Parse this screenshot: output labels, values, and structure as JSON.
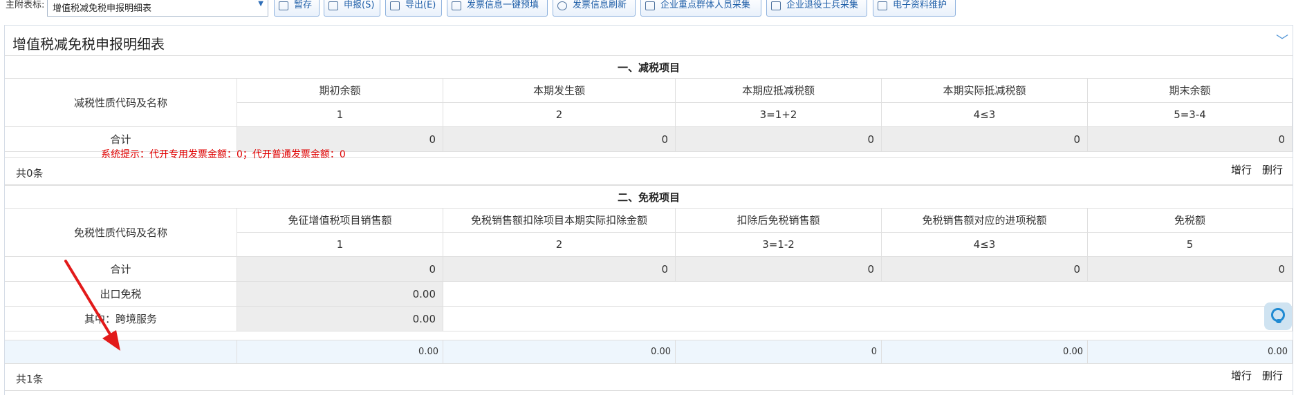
{
  "toolbar": {
    "label": "主附表标:",
    "select_value": "增值税减免税申报明细表",
    "buttons": {
      "save": "暂存",
      "declare": "申报(S)",
      "export": "导出(E)",
      "invoice_prefill": "发票信息一键预填",
      "invoice_refresh": "发票信息刷新",
      "key_group": "企业重点群体人员采集",
      "veteran": "企业退役士兵采集",
      "edoc": "电子资料维护"
    }
  },
  "panel": {
    "title": "增值税减免税申报明细表"
  },
  "tax_reduction": {
    "section_title": "一、减税项目",
    "row_header": "减税性质代码及名称",
    "columns": [
      "期初余额",
      "本期发生额",
      "本期应抵减税额",
      "本期实际抵减税额",
      "期末余额"
    ],
    "column_codes": [
      "1",
      "2",
      "3=1+2",
      "4≤3",
      "5=3-4"
    ],
    "total_label": "合计",
    "totals": [
      "0",
      "0",
      "0",
      "0",
      "0"
    ],
    "hint": "系统提示：代开专用发票金额：0；代开普通发票金额：0",
    "count": "共0条",
    "add_row": "增行",
    "delete_row": "删行"
  },
  "tax_exemption": {
    "section_title": "二、免税项目",
    "row_header": "免税性质代码及名称",
    "columns": [
      "免征增值税项目销售额",
      "免税销售额扣除项目本期实际扣除金额",
      "扣除后免税销售额",
      "免税销售额对应的进项税额",
      "免税额"
    ],
    "column_codes": [
      "1",
      "2",
      "3=1-2",
      "4≤3",
      "5"
    ],
    "total_label": "合计",
    "totals": [
      "0",
      "0",
      "0",
      "0",
      "0"
    ],
    "export_label": "出口免税",
    "export_value": "0.00",
    "cross_border_label": "其中：跨境服务",
    "cross_border_value": "0.00",
    "input_row": [
      "",
      "0.00",
      "0.00",
      "0",
      "0.00",
      "0.00"
    ],
    "count": "共1条",
    "add_row": "增行",
    "delete_row": "删行"
  }
}
